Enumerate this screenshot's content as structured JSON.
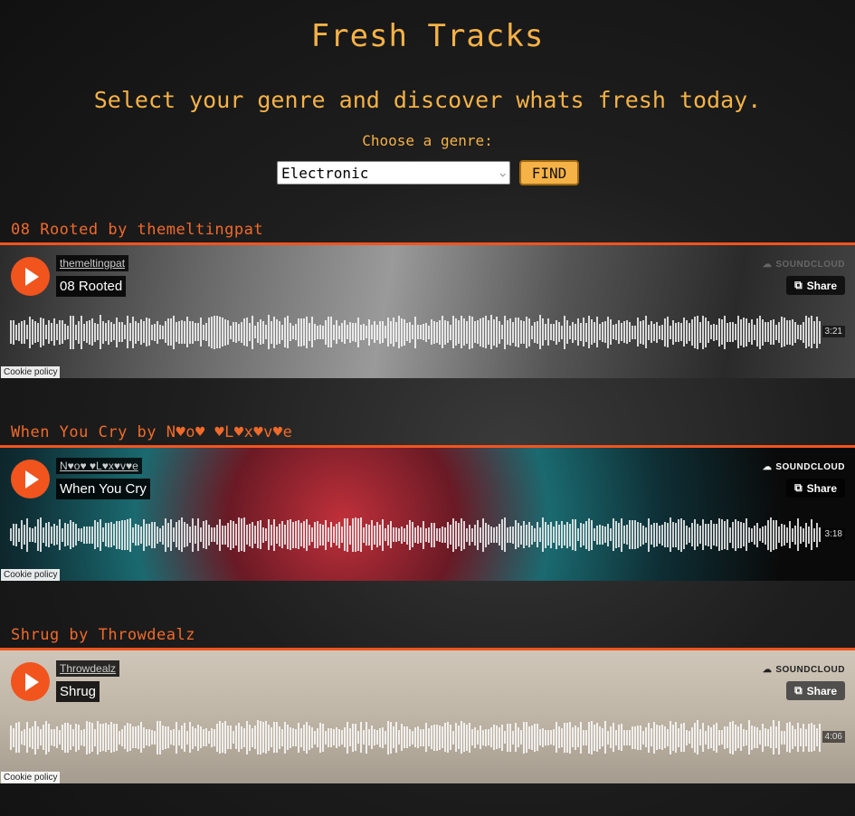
{
  "header": {
    "title": "Fresh Tracks",
    "subtitle": "Select your genre and discover whats fresh today.",
    "genre_label": "Choose a genre:",
    "genre_selected": "Electronic",
    "find_label": "FIND"
  },
  "colors": {
    "accent": "#f5b247",
    "heading": "#f06a2a",
    "soundcloud_orange": "#f2541e"
  },
  "tracks": [
    {
      "heading": "08 Rooted by themeltingpat",
      "artist": "themeltingpat",
      "title": "08 Rooted",
      "brand": "SOUNDCLOUD",
      "share": "Share",
      "duration": "3:21",
      "cookie": "Cookie policy"
    },
    {
      "heading": "When You Cry by N♥o♥ ♥L♥x♥v♥e",
      "artist": "N♥o♥ ♥L♥x♥v♥e",
      "title": "When You Cry",
      "brand": "SOUNDCLOUD",
      "share": "Share",
      "duration": "3:18",
      "cookie": "Cookie policy"
    },
    {
      "heading": "Shrug by Throwdealz",
      "artist": "Throwdealz",
      "title": "Shrug",
      "brand": "SOUNDCLOUD",
      "share": "Share",
      "duration": "4:06",
      "cookie": "Cookie policy"
    }
  ]
}
